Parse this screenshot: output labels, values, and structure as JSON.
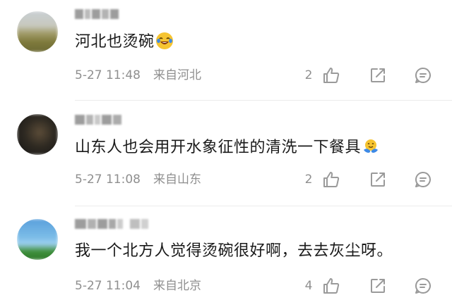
{
  "comments": [
    {
      "text": "河北也烫碗",
      "emoji": "laughing-tears-emoji",
      "time": "5-27 11:48",
      "location": "来自河北",
      "likes": "2"
    },
    {
      "text": "山东人也会用开水象征性的清洗一下餐具",
      "emoji": "hug-emoji",
      "time": "5-27 11:08",
      "location": "来自山东",
      "likes": "2"
    },
    {
      "text": "我一个北方人觉得烫碗很好啊，去去灰尘呀。",
      "emoji": "",
      "time": "5-27 11:04",
      "location": "来自北京",
      "likes": "4"
    }
  ],
  "icons": {
    "like": "thumbs-up-icon",
    "share": "share-icon",
    "reply": "comment-icon"
  },
  "colors": {
    "meta_text": "#8f8f8f",
    "icon": "#9a9a9a",
    "emoji_yellow": "#f6c431",
    "emoji_blue": "#3e8ae6"
  }
}
